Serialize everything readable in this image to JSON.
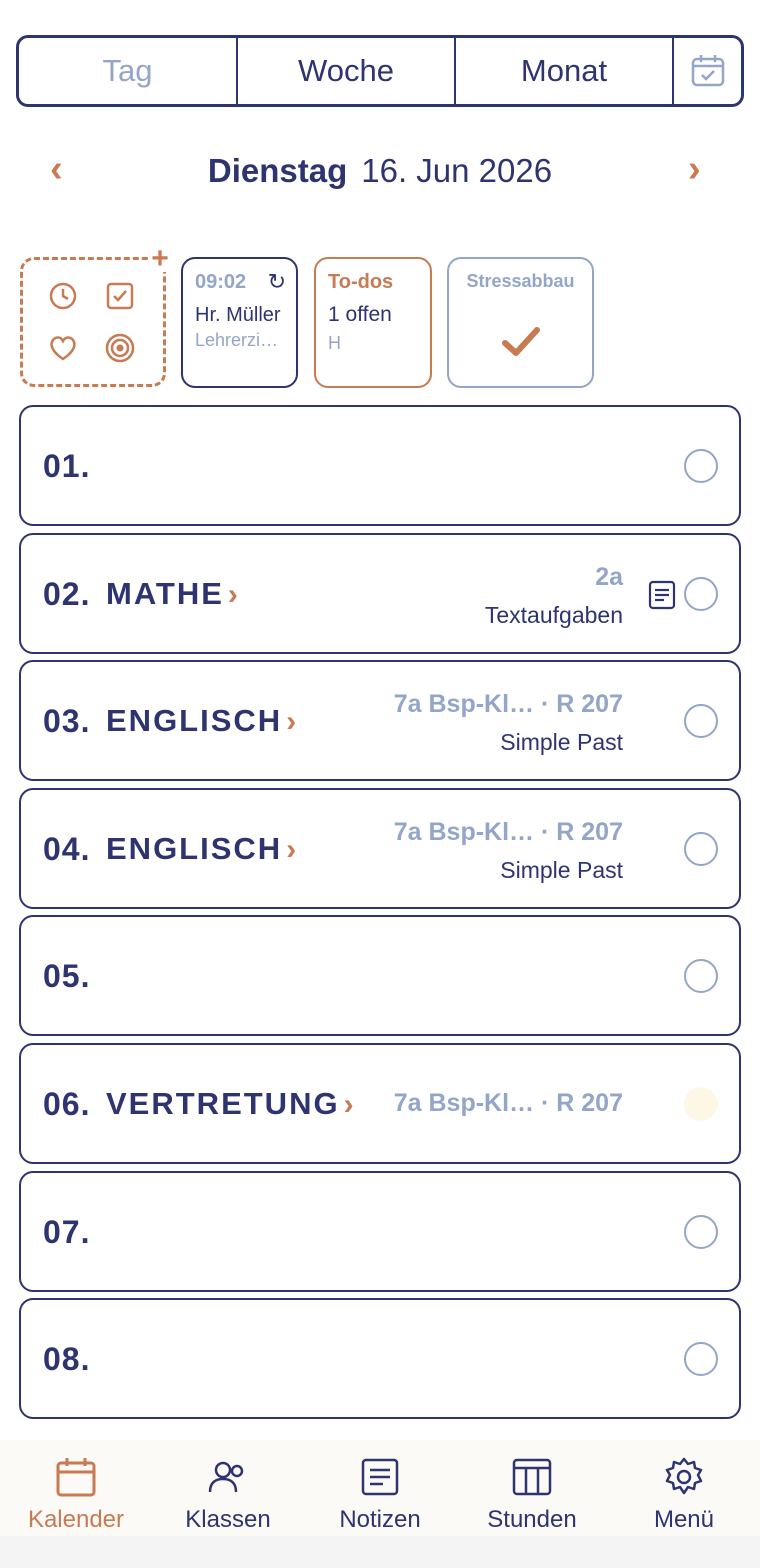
{
  "view_switch": {
    "day": "Tag",
    "week": "Woche",
    "month": "Monat",
    "calendar_icon": "calendar-check-icon"
  },
  "date_nav": {
    "prev": "‹",
    "next": "›",
    "weekday": "Dienstag",
    "date": "16. Jun 2026"
  },
  "quick_add": {
    "plus": "+",
    "icons": [
      "clock-icon",
      "checkbox-icon",
      "heart-icon",
      "target-icon"
    ]
  },
  "widgets": {
    "time": {
      "value": "09:02",
      "refresh": "↻",
      "name": "Hr. Müller",
      "sub": "Lehrerzi…"
    },
    "todos": {
      "title": "To-dos",
      "count": "1 offen",
      "sub": "H"
    },
    "stress": {
      "title": "Stressabbau",
      "icon": "checkmark-icon"
    }
  },
  "lessons": [
    {
      "num": "01.",
      "subject": "",
      "meta": "",
      "topic": ""
    },
    {
      "num": "02.",
      "subject": "MATHE",
      "meta": "2a",
      "topic": "Textaufgaben"
    },
    {
      "num": "03.",
      "subject": "ENGLISCH",
      "meta": "7a Bsp-Kl…  ·  R 207",
      "topic": "Simple Past"
    },
    {
      "num": "04.",
      "subject": "ENGLISCH",
      "meta": "7a Bsp-Kl…  ·  R 207",
      "topic": "Simple Past"
    },
    {
      "num": "05.",
      "subject": "",
      "meta": "",
      "topic": ""
    },
    {
      "num": "06.",
      "subject": "VERTRETUNG",
      "meta": "7a Bsp-Kl…  ·  R 207",
      "topic": ""
    },
    {
      "num": "07.",
      "subject": "",
      "meta": "",
      "topic": ""
    },
    {
      "num": "08.",
      "subject": "",
      "meta": "",
      "topic": ""
    }
  ],
  "lesson_chevron": "›",
  "bottom_nav": {
    "calendar": "Kalender",
    "classes": "Klassen",
    "notes": "Notizen",
    "hours": "Stunden",
    "menu": "Menü"
  },
  "colors": {
    "primary": "#2e3470",
    "accent": "#c87a52",
    "muted": "#93a5c8"
  }
}
